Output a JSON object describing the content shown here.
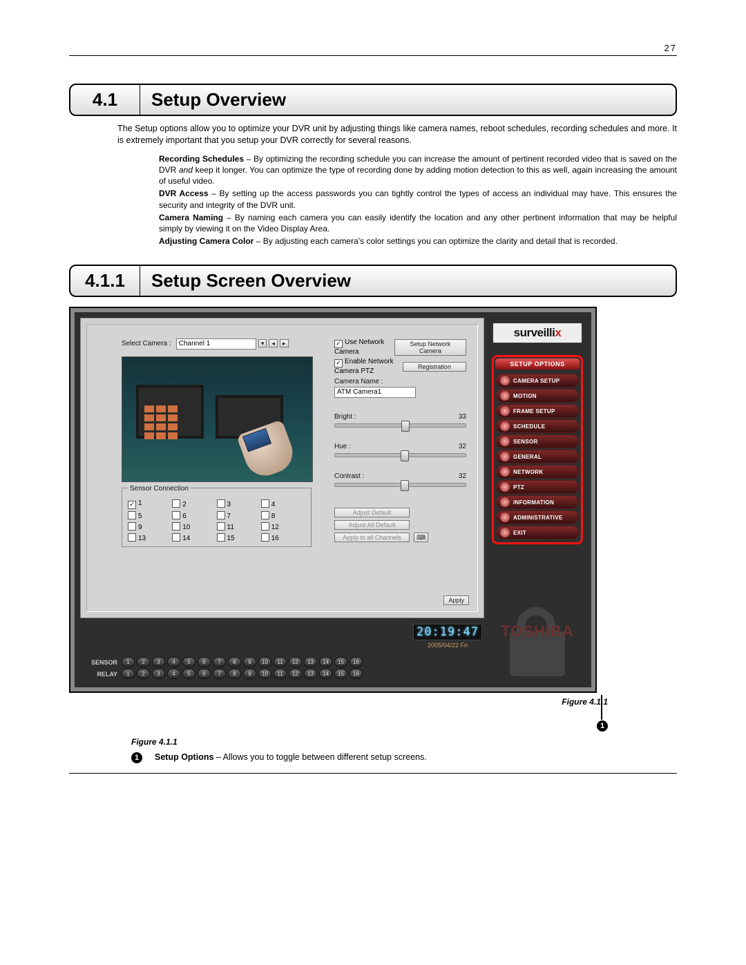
{
  "page_number": "27",
  "section1": {
    "num": "4.1",
    "title": "Setup Overview"
  },
  "intro": "The Setup options allow you to optimize your DVR unit by adjusting things like camera names, reboot schedules, recording schedules and more. It is extremely important that you setup your DVR correctly for several reasons.",
  "details": {
    "rec_b": "Recording Schedules",
    "rec_t": " – By optimizing the recording schedule you can increase the amount of pertinent recorded video that is saved on the DVR ",
    "rec_i": "and",
    "rec_t2": " keep it longer. You can optimize the type of recording done by adding motion detection to this as well, again increasing the amount of useful video.",
    "dvr_b": "DVR Access",
    "dvr_t": " – By setting up the access passwords you can tightly control the types of access an individual may have. This ensures the security and integrity of the DVR unit.",
    "cam_b": "Camera Naming",
    "cam_t": " – By naming each camera you can easily identify the location and any other pertinent information that may be helpful simply by viewing it on the Video Display Area.",
    "adj_b": "Adjusting Camera Color",
    "adj_t": " – By adjusting each camera's color settings you can optimize the clarity and detail that is recorded."
  },
  "section2": {
    "num": "4.1.1",
    "title": "Setup Screen Overview"
  },
  "screenshot": {
    "brand": "surveillix",
    "setup_options_header": "SETUP OPTIONS",
    "options": [
      "CAMERA SETUP",
      "MOTION",
      "FRAME SETUP",
      "SCHEDULE",
      "SENSOR",
      "GENERAL",
      "NETWORK",
      "PTZ",
      "INFORMATION",
      "ADMINISTRATIVE",
      "EXIT"
    ],
    "select_camera_label": "Select Camera :",
    "select_camera_value": "Channel 1",
    "use_network_camera": "Use Network Camera",
    "enable_ptz": "Enable Network Camera PTZ",
    "setup_net_cam_btn": "Setup Network Camera",
    "registration_btn": "Registration",
    "camera_name_label": "Camera Name :",
    "camera_name_value": "ATM Camera1",
    "bright_label": "Bright :",
    "bright_value": "33",
    "hue_label": "Hue :",
    "hue_value": "32",
    "contrast_label": "Contrast :",
    "contrast_value": "32",
    "sensor_conn_label": "Sensor Connection",
    "adjust_default_btn": "Adjust Default",
    "adjust_all_default_btn": "Adjust All Default",
    "apply_all_channels_btn": "Apply to all Channels",
    "apply_btn": "Apply",
    "clock_time": "20:19:47",
    "clock_date": "2005/04/22 Fri",
    "sensor_row_label": "SENSOR",
    "relay_row_label": "RELAY",
    "toshiba": "TOSHIBA"
  },
  "figure_caption": "Figure 4.1.1",
  "legend": {
    "num": "1",
    "b": "Setup Options",
    "t": " – Allows you to toggle between different setup screens."
  }
}
